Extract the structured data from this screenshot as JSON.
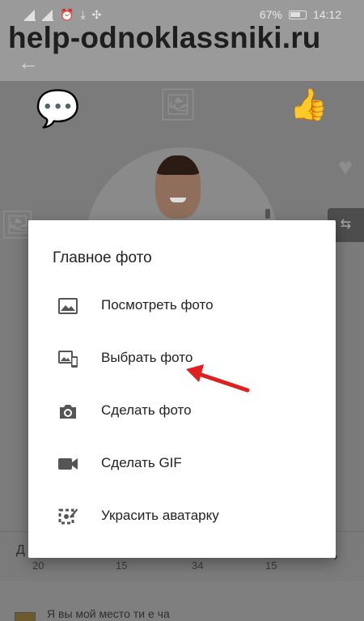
{
  "status_bar": {
    "battery_percent": "67%",
    "time": "14:12"
  },
  "watermark": "help-odnoklassniki.ru",
  "profile": {
    "stats_label_first_char": "Д",
    "stats": [
      "20",
      "15",
      "34",
      "15"
    ],
    "bottom_text": "Я   вы мой    место   ти  е ча"
  },
  "dialog": {
    "title": "Главное фото",
    "items": [
      {
        "label": "Посмотреть фото",
        "icon": "image-icon"
      },
      {
        "label": "Выбрать фото",
        "icon": "gallery-phone-icon"
      },
      {
        "label": "Сделать фото",
        "icon": "camera-icon"
      },
      {
        "label": "Сделать GIF",
        "icon": "video-camera-icon"
      },
      {
        "label": "Украсить аватарку",
        "icon": "decorate-avatar-icon"
      }
    ]
  },
  "colors": {
    "annotation_arrow": "#e02020",
    "icon": "#555555"
  }
}
